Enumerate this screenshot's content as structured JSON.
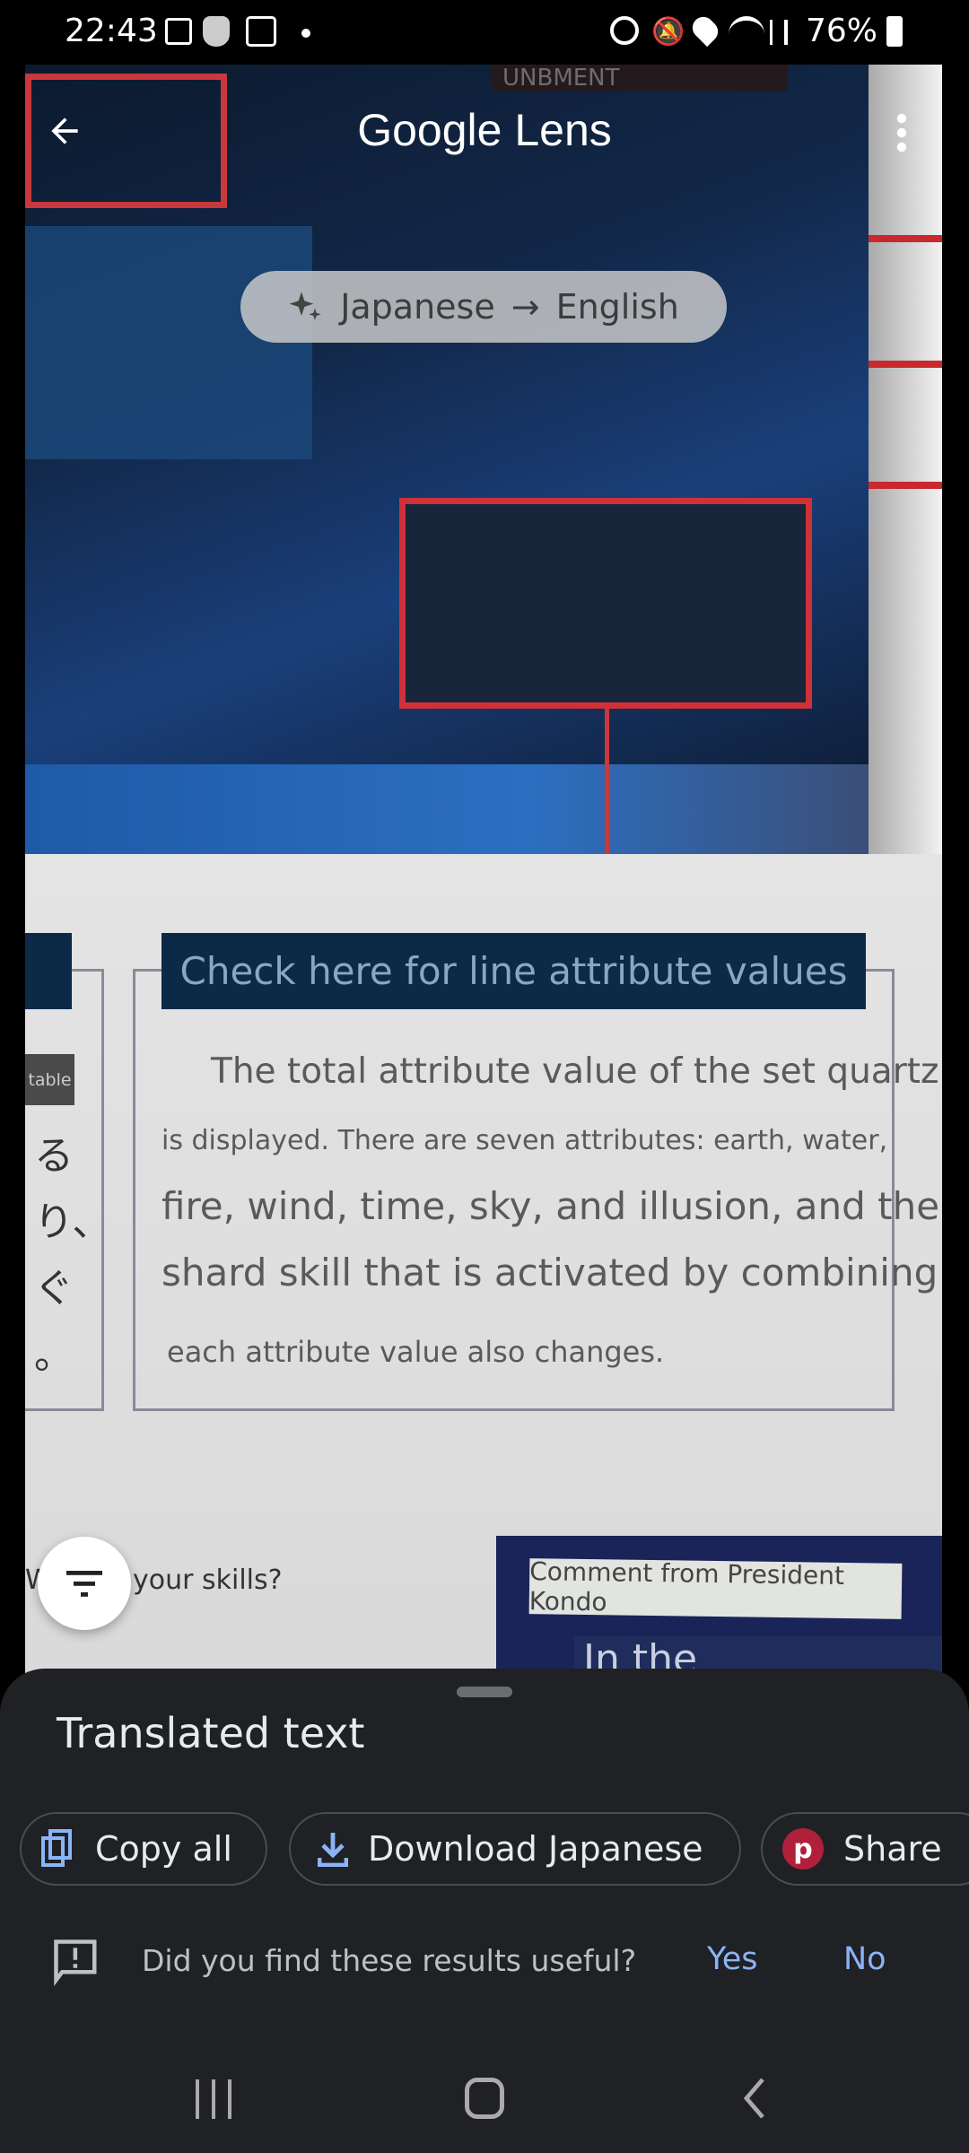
{
  "status_bar": {
    "time": "22:43",
    "battery": "76%",
    "left_icons": [
      "gallery-icon",
      "brave-icon",
      "play-icon",
      "dot-icon"
    ],
    "right_icons": [
      "alarm-icon",
      "mute-icon",
      "location-icon",
      "wifi-icon",
      "signal-icon",
      "battery-icon"
    ]
  },
  "header": {
    "title": "Google Lens",
    "back_icon": "arrow-left-icon",
    "menu_icon": "more-vert-icon"
  },
  "language": {
    "source": "Japanese",
    "arrow": "→",
    "target": "English",
    "icon": "sparkle-icon"
  },
  "overlay": {
    "top_label": "UNBMENT",
    "heading": "Check here for line attribute values",
    "paragraph": [
      "The total attribute value of the set quartz",
      "is displayed. There are seven attributes: earth, water,",
      "fire, wind, time, sky, and illusion, and the",
      "shard skill that is activated by combining",
      "each attribute value also changes."
    ],
    "side_tag": "table",
    "side_chars": [
      "る",
      "り、",
      "ぐ",
      "。"
    ],
    "question": "W",
    "question_rest": "your skills?",
    "comment": "Comment from President Kondo",
    "partial": "In the"
  },
  "sheet": {
    "title": "Translated text",
    "actions": [
      {
        "label": "Copy all",
        "icon": "copy-icon"
      },
      {
        "label": "Download Japanese",
        "icon": "download-icon"
      },
      {
        "label": "Share",
        "icon": "pinterest-icon"
      }
    ],
    "feedback": {
      "question": "Did you find these results useful?",
      "yes": "Yes",
      "no": "No"
    },
    "accent": "#8ab4f8"
  },
  "nav": {
    "icons": [
      "recents-icon",
      "home-icon",
      "back-icon"
    ]
  }
}
